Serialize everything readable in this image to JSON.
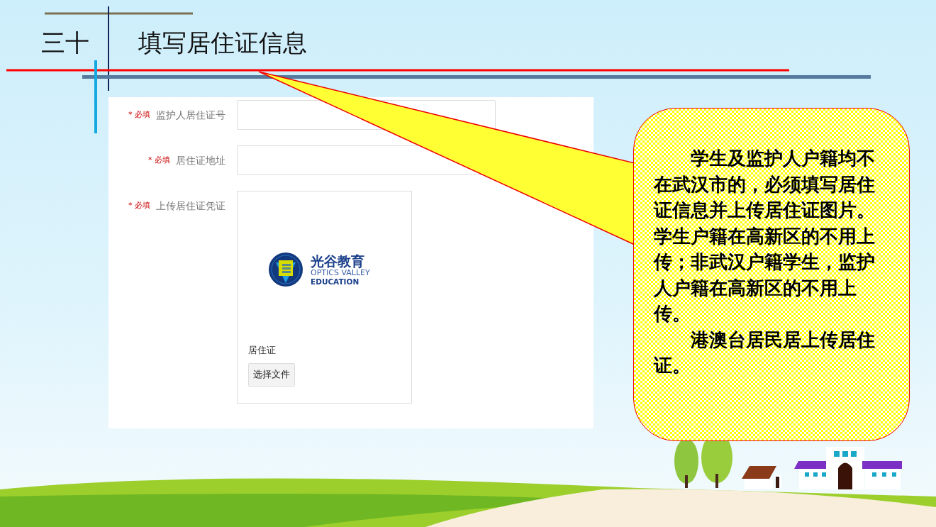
{
  "slide": {
    "number": "三十",
    "title": "填写居住证信息"
  },
  "form": {
    "fields": [
      {
        "kind": "text",
        "required_mark": "*",
        "required_text": "必填",
        "label": "监护人居住证号"
      },
      {
        "kind": "text",
        "required_mark": "*",
        "required_text": "必填",
        "label": "居住证地址"
      },
      {
        "kind": "upload",
        "required_mark": "*",
        "required_text": "必填",
        "label": "上传居住证凭证",
        "logo": {
          "name_cn": "光谷教育",
          "name_en_1": "OPTICS VALLEY",
          "name_en_2": "EDUCATION"
        },
        "caption": "居住证",
        "button": "选择文件"
      }
    ]
  },
  "callout": {
    "paragraphs": [
      "学生及监护人户籍均不在武汉市的，必须填写居住证信息并上传居住证图片。学生户籍在高新区的不用上传；非武汉户籍学生，监护人户籍在高新区的不用上传。",
      "港澳台居民居上传居住证。"
    ]
  }
}
